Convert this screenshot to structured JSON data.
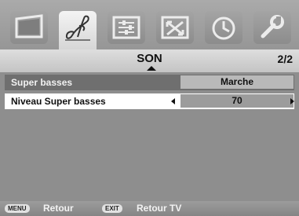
{
  "tabs": [
    {
      "name": "picture-icon",
      "active": false
    },
    {
      "name": "sound-note-icon",
      "active": true
    },
    {
      "name": "settings-sliders-icon",
      "active": false
    },
    {
      "name": "connections-arrows-icon",
      "active": false
    },
    {
      "name": "timer-clock-icon",
      "active": false
    },
    {
      "name": "setup-wrench-icon",
      "active": false
    }
  ],
  "menu": {
    "title": "SON",
    "page": "2/2"
  },
  "rows": [
    {
      "label": "Super basses",
      "value": "Marche",
      "selected": false
    },
    {
      "label": "Niveau Super basses",
      "value": "70",
      "selected": true
    }
  ],
  "footer": {
    "menu_key": "MENU",
    "menu_label": "Retour",
    "exit_key": "EXIT",
    "exit_label": "Retour TV"
  }
}
